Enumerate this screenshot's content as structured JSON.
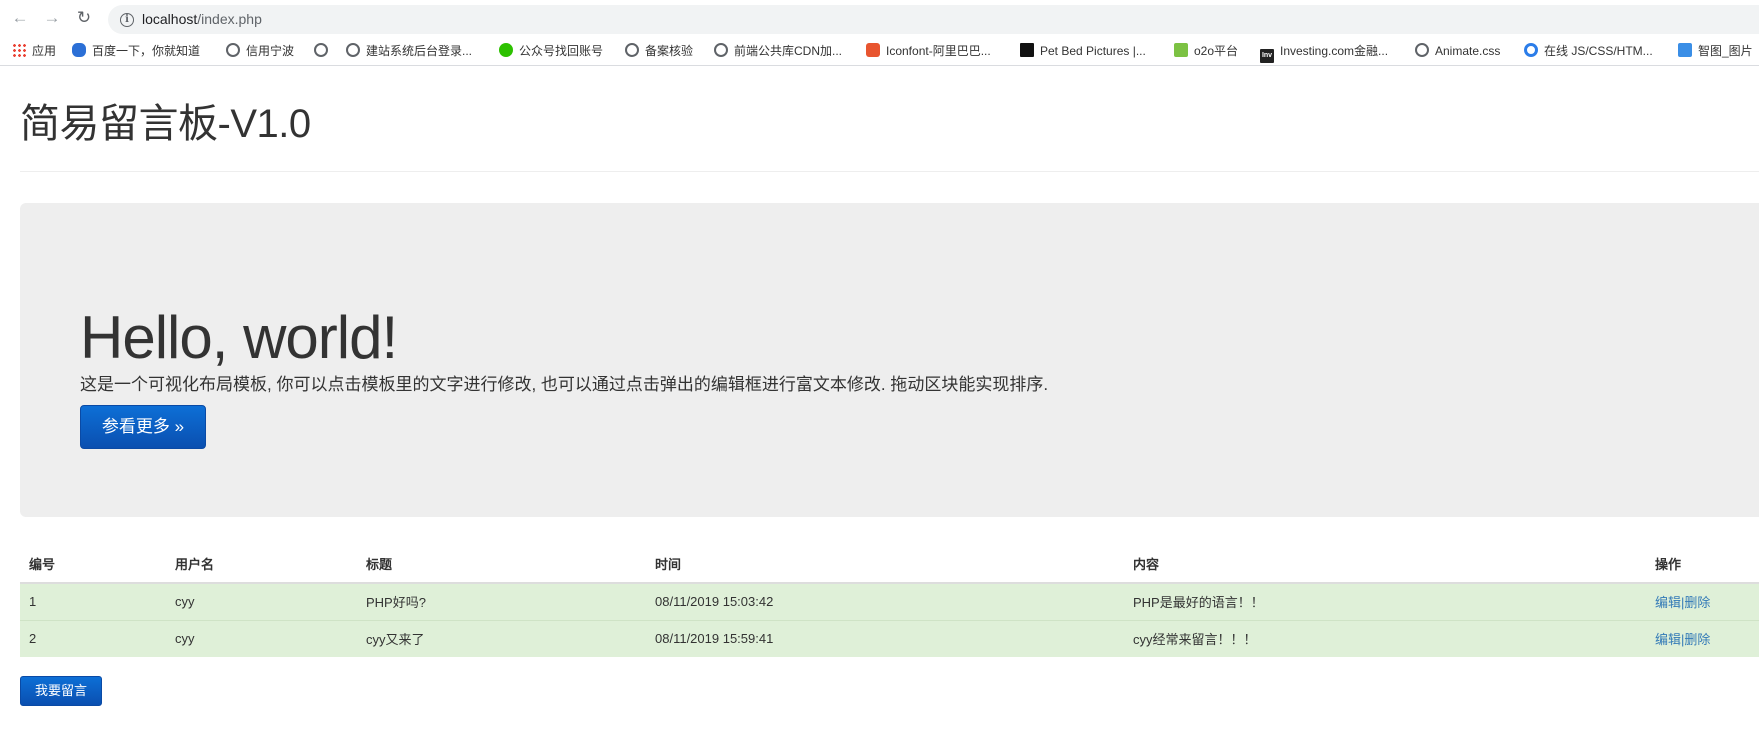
{
  "browser": {
    "url_host": "localhost",
    "url_path": "/index.php",
    "bookmarks": [
      {
        "label": "应用",
        "icon": "apps-grid-icon"
      },
      {
        "label": "百度一下，你就知道",
        "icon": "baidu-paw-icon"
      },
      {
        "label": "信用宁波",
        "icon": "globe-icon"
      },
      {
        "label": "",
        "icon": "globe-icon"
      },
      {
        "label": "建站系统后台登录...",
        "icon": "globe-icon"
      },
      {
        "label": "公众号找回账号",
        "icon": "wechat-icon"
      },
      {
        "label": "备案核验",
        "icon": "globe-icon"
      },
      {
        "label": "前端公共库CDN加...",
        "icon": "globe-icon"
      },
      {
        "label": "Iconfont-阿里巴巴...",
        "icon": "iconfont-icon"
      },
      {
        "label": "Pet Bed Pictures |...",
        "icon": "pet-bed-icon"
      },
      {
        "label": "o2o平台",
        "icon": "o2o-icon"
      },
      {
        "label": "Investing.com金融...",
        "icon": "investing-icon"
      },
      {
        "label": "Animate.css",
        "icon": "globe-icon"
      },
      {
        "label": "在线 JS/CSS/HTM...",
        "icon": "c-logo-icon"
      },
      {
        "label": "智图_图片",
        "icon": "zhitu-icon"
      }
    ]
  },
  "page": {
    "title": "简易留言板-V1.0",
    "jumbotron": {
      "heading": "Hello, world!",
      "text": "这是一个可视化布局模板, 你可以点击模板里的文字进行修改, 也可以通过点击弹出的编辑框进行富文本修改. 拖动区块能实现排序.",
      "button": "参看更多 »"
    },
    "table": {
      "headers": [
        "编号",
        "用户名",
        "标题",
        "时间",
        "内容",
        "操作"
      ],
      "rows": [
        {
          "id": "1",
          "user": "cyy",
          "title": "PHP好吗?",
          "time": "08/11/2019 15:03:42",
          "content": "PHP是最好的语言！！",
          "edit": "编辑",
          "sep": "|",
          "delete": "删除"
        },
        {
          "id": "2",
          "user": "cyy",
          "title": "cyy又来了",
          "time": "08/11/2019 15:59:41",
          "content": "cyy经常来留言！！！",
          "edit": "编辑",
          "sep": "|",
          "delete": "删除"
        }
      ]
    },
    "leave_message_button": "我要留言"
  }
}
